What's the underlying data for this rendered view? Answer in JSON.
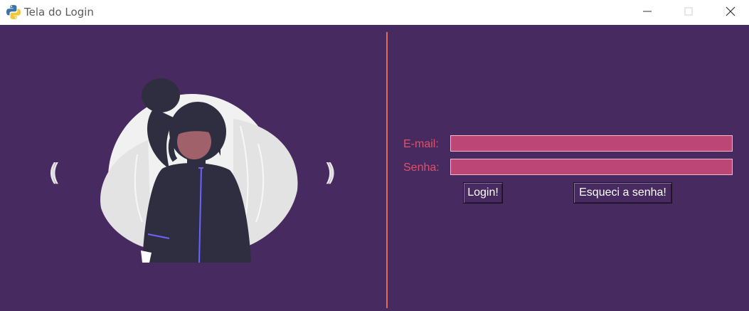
{
  "window": {
    "title": "Tela do Login",
    "controls": [
      "minimize-icon",
      "maximize-icon",
      "close-icon"
    ]
  },
  "carousel": {
    "prev_label": "((",
    "next_label": "))"
  },
  "form": {
    "email_label": "E-mail:",
    "email_value": "",
    "password_label": "Senha:",
    "password_value": "",
    "login_button": "Login!",
    "forgot_button": "Esqueci a senha!"
  },
  "colors": {
    "background": "#472a60",
    "divider": "#e06c5e",
    "label": "#e0506a",
    "field": "#bc4776"
  }
}
